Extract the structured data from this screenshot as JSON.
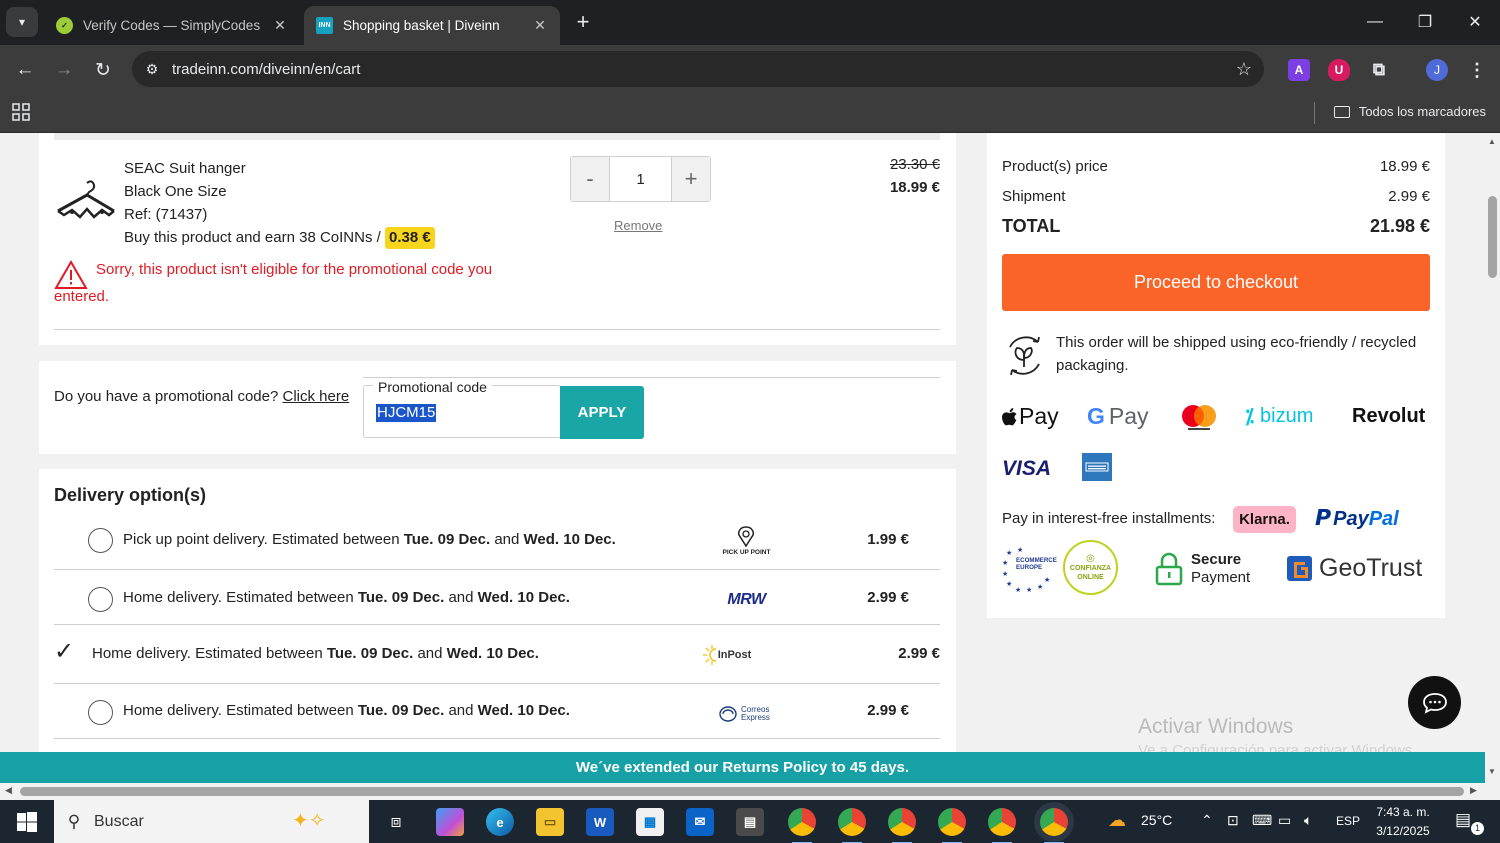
{
  "browser": {
    "tabs": [
      {
        "title": "Verify Codes — SimplyCodes",
        "active": false
      },
      {
        "title": "Shopping basket | Diveinn",
        "active": true
      }
    ],
    "url": "tradeinn.com/diveinn/en/cart",
    "bookmarks_all_label": "Todos los marcadores",
    "profile_initial": "J"
  },
  "cart_item": {
    "name": "SEAC Suit hanger",
    "variant": "Black One Size",
    "ref": "Ref: (71437)",
    "coins_text": "Buy this product and earn 38 CoINNs /",
    "coins_value": "0.38 €",
    "quantity": "1",
    "qty_minus": "-",
    "qty_plus": "+",
    "remove_label": "Remove",
    "price_old": "23.30 €",
    "price_new": "18.99 €",
    "warning": "Sorry, this product isn't eligible for the promotional code you entered."
  },
  "promo": {
    "question": "Do you have a promotional code?",
    "link": "Click here",
    "field_label": "Promotional code",
    "value": "HJCM15",
    "apply_label": "APPLY"
  },
  "delivery": {
    "title": "Delivery option(s)",
    "options": [
      {
        "prefix": "Pick up point delivery. Estimated between",
        "from": "Tue. 09 Dec.",
        "and": "and",
        "to": "Wed. 10 Dec.",
        "carrier": "PICK UP POINT",
        "price": "1.99 €",
        "selected": false
      },
      {
        "prefix": "Home delivery. Estimated between",
        "from": "Tue. 09 Dec.",
        "and": "and",
        "to": "Wed. 10 Dec.",
        "carrier": "MRW",
        "price": "2.99 €",
        "selected": false
      },
      {
        "prefix": "Home delivery. Estimated between",
        "from": "Tue. 09 Dec.",
        "and": "and",
        "to": "Wed. 10 Dec.",
        "carrier": "InPost",
        "price": "2.99 €",
        "selected": true
      },
      {
        "prefix": "Home delivery. Estimated between",
        "from": "Tue. 09 Dec.",
        "and": "and",
        "to": "Wed. 10 Dec.",
        "carrier": "Correos Express",
        "price": "2.99 €",
        "selected": false
      }
    ]
  },
  "summary": {
    "products_label": "Product(s) price",
    "products_value": "18.99 €",
    "shipment_label": "Shipment",
    "shipment_value": "2.99 €",
    "total_label": "TOTAL",
    "total_value": "21.98 €",
    "checkout_label": "Proceed to checkout",
    "eco_text": "This order will be shipped using eco-friendly / recycled packaging.",
    "payment_methods": [
      "Apple Pay",
      "G Pay",
      "Mastercard",
      "bizum",
      "Revolut",
      "VISA",
      "American Express"
    ],
    "apple_pay": "Pay",
    "google_pay": "Pay",
    "bizum": "bizum",
    "revolut": "Revolut",
    "visa": "VISA",
    "installments_label": "Pay in interest-free installments:",
    "klarna": "Klarna.",
    "paypal_1": "Pay",
    "paypal_2": "Pal",
    "trust_ecommerce": "ECOMMERCE EUROPE",
    "trust_confianza": "CONFIANZA ONLINE",
    "secure_1": "Secure",
    "secure_2": "Payment",
    "geotrust": "GeoTrust"
  },
  "banner": "We´ve extended our Returns Policy to 45 days.",
  "watermark": {
    "line1": "Activar Windows",
    "line2": "Ve a Configuración para activar Windows."
  },
  "taskbar": {
    "search_placeholder": "Buscar",
    "weather": "25°C",
    "language": "ESP",
    "time": "7:43 a. m.",
    "date": "3/12/2025",
    "notifications": "1"
  },
  "colors": {
    "checkout": "#fb6428",
    "teal": "#1aa5a6",
    "warning": "#e01b24",
    "coins": "#f7d51d"
  }
}
